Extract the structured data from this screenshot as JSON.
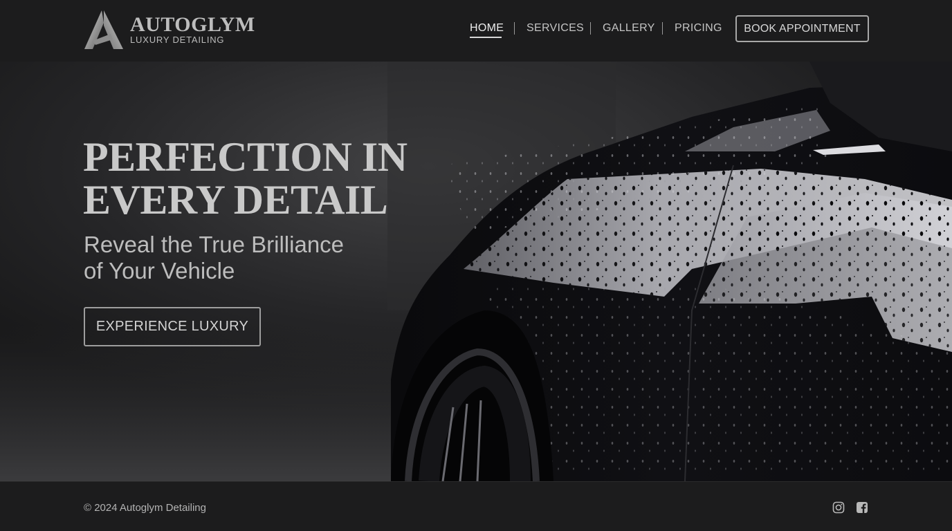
{
  "brand": {
    "name": "AUTOGLYM",
    "tagline": "LUXURY DETAILING"
  },
  "nav": {
    "items": [
      {
        "label": "HOME",
        "active": true
      },
      {
        "label": "SERVICES",
        "active": false
      },
      {
        "label": "GALLERY",
        "active": false
      },
      {
        "label": "PRICING",
        "active": false
      }
    ],
    "book_label": "BOOK APPOINTMENT"
  },
  "hero": {
    "title": "PERFECTION IN\nEVERY DETAIL",
    "subtitle": "Reveal the True Brilliance\nof Your Vehicle",
    "cta_label": "EXPERIENCE LUXURY"
  },
  "footer": {
    "copyright": "© 2024 Autoglym Detailing",
    "social": [
      {
        "icon": "instagram-icon"
      },
      {
        "icon": "facebook-icon"
      }
    ]
  },
  "colors": {
    "background": "#1b1b1c",
    "text": "#d6d6d6",
    "accent": "#a8a8a8"
  }
}
